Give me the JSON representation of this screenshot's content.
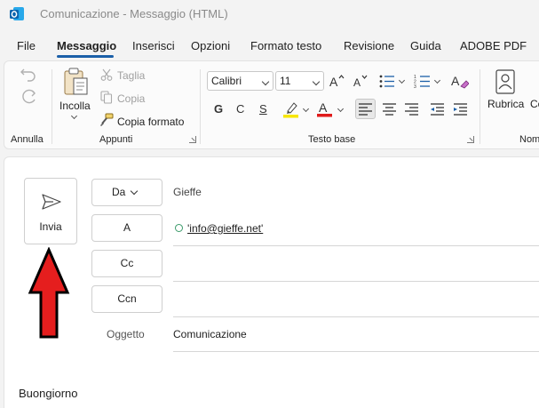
{
  "window": {
    "title": "Comunicazione  -  Messaggio (HTML)"
  },
  "tabs": [
    {
      "label": "File"
    },
    {
      "label": "Messaggio",
      "active": true
    },
    {
      "label": "Inserisci"
    },
    {
      "label": "Opzioni"
    },
    {
      "label": "Formato testo"
    },
    {
      "label": "Revisione"
    },
    {
      "label": "Guida"
    },
    {
      "label": "ADOBE PDF"
    }
  ],
  "ribbon": {
    "undo_group": {
      "label": "Annulla"
    },
    "clipboard": {
      "label": "Appunti",
      "paste_label": "Incolla",
      "cut_label": "Taglia",
      "copy_label": "Copia",
      "format_painter_label": "Copia formato"
    },
    "basic_text": {
      "label": "Testo base",
      "font_name": "Calibri",
      "font_size": "11",
      "bold": "G",
      "italic": "C",
      "underline": "S"
    },
    "names": {
      "label": "Nom",
      "address_book_label": "Rubrica",
      "check_names_label": "Co"
    }
  },
  "compose": {
    "send_label": "Invia",
    "from_button": "Da",
    "from_value": "Gieffe",
    "to_button": "A",
    "to_value": "'info@gieffe.net'",
    "cc_button": "Cc",
    "bcc_button": "Ccn",
    "subject_label": "Oggetto",
    "subject_value": "Comunicazione",
    "body_text": "Buongiorno"
  },
  "colors": {
    "accent": "#1b5fa8",
    "highlight": "#f7e600",
    "font_color": "#e01b1b",
    "arrow": "#e51e1e"
  }
}
